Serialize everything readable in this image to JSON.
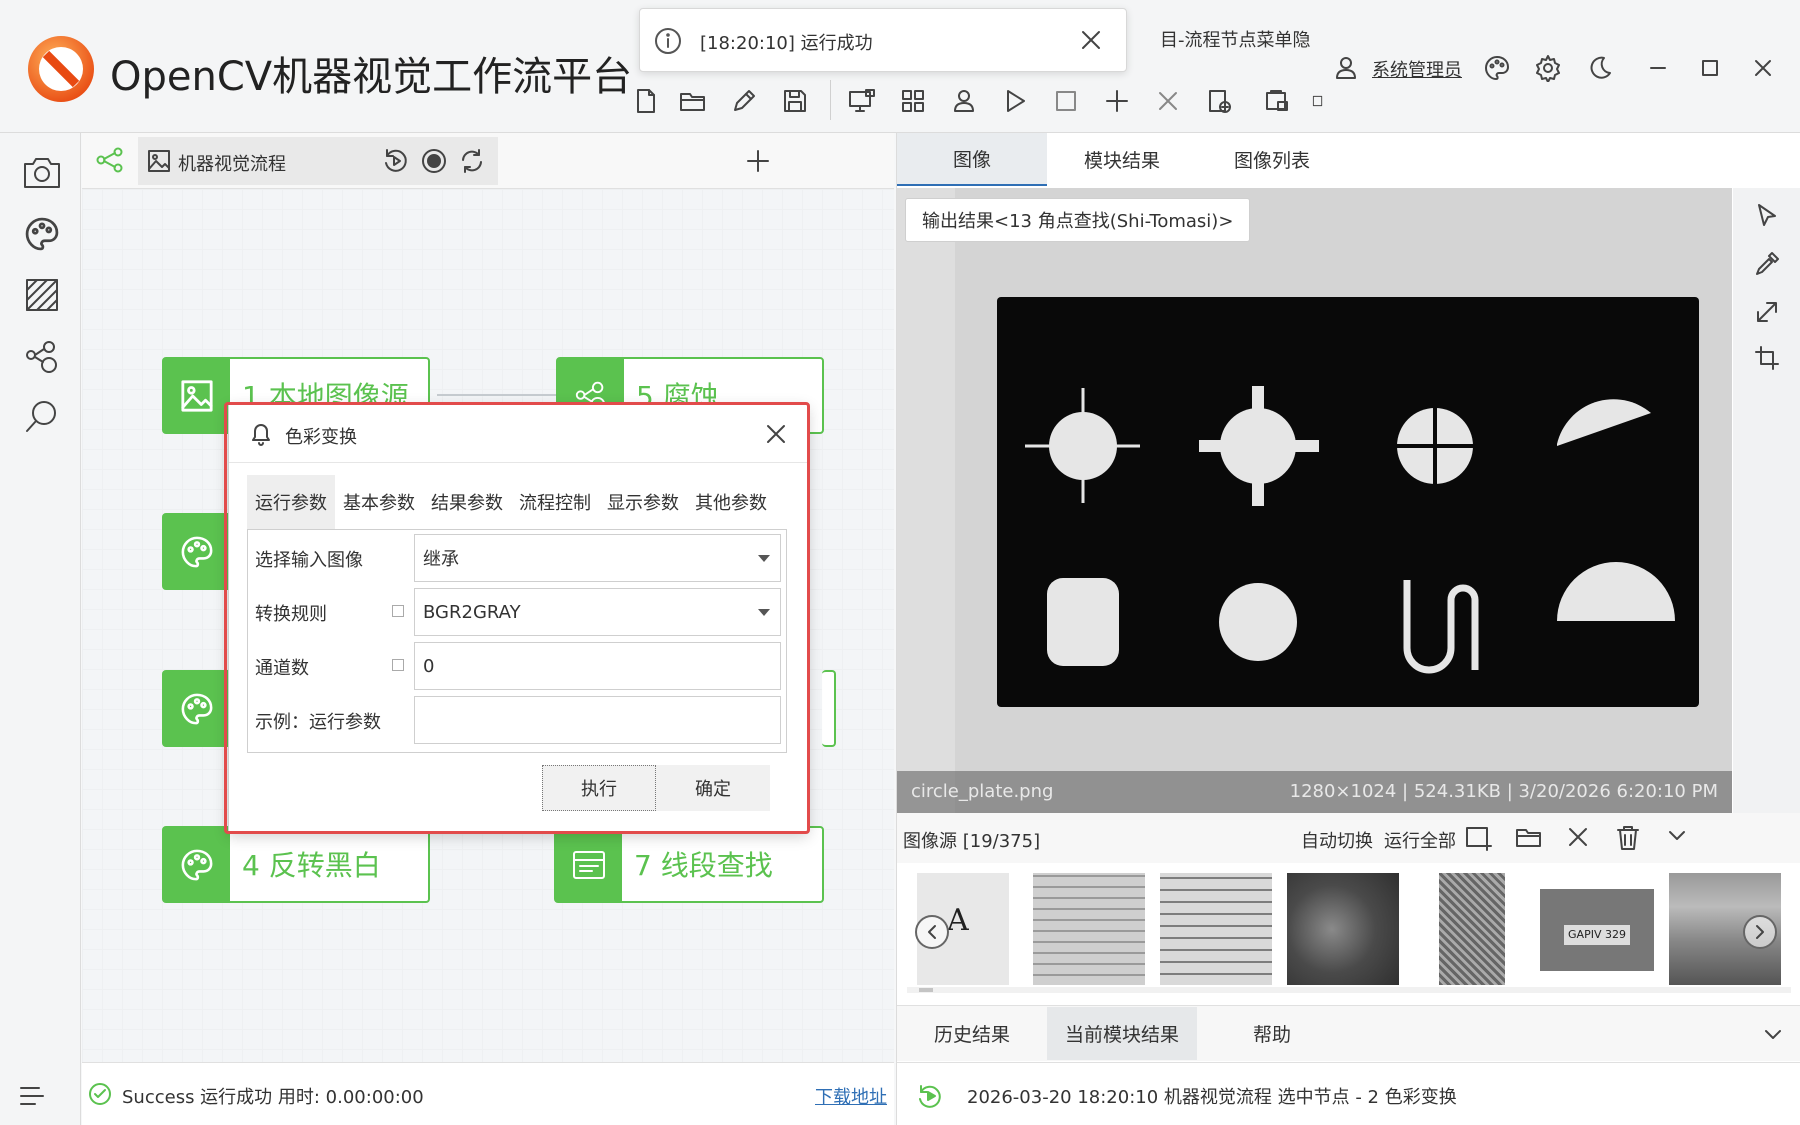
{
  "app": {
    "title": "OpenCV机器视觉工作流平台"
  },
  "toast": {
    "message": "[18:20:10] 运行成功"
  },
  "header": {
    "hidden_text": "目-流程节点菜单隐",
    "user": "系统管理员"
  },
  "toolbar": {
    "icons": [
      "new-file-icon",
      "open-folder-icon",
      "edit-icon",
      "save-icon",
      "monitor-icon",
      "modules-icon",
      "user-icon",
      "play-icon",
      "stop-icon",
      "add-icon",
      "delete-icon",
      "export-icon",
      "import-icon"
    ]
  },
  "flow": {
    "tab_title": "机器视觉流程",
    "nodes": [
      {
        "label": "1 本地图像源"
      },
      {
        "label": "5 腐蚀"
      },
      {
        "label": "4 反转黑白"
      },
      {
        "label": "7 线段查找"
      }
    ]
  },
  "status": {
    "text": "Success 运行成功 用时: 0.00:00:00",
    "download_link": "下载地址"
  },
  "right": {
    "tabs": [
      "图像",
      "模块结果",
      "图像列表"
    ],
    "overlay_button": "输出结果<13 角点查找(Shi-Tomasi)>",
    "image_filename": "circle_plate.png",
    "image_info": "1280×1024 | 524.31KB | 3/20/2026 6:20:10 PM",
    "source_label": "图像源 [19/375]",
    "auto_switch": "自动切换",
    "run_all": "运行全部",
    "bottom_tabs": [
      "历史结果",
      "当前模块结果",
      "帮助"
    ],
    "log_text": "2026-03-20 18:20:10 机器视觉流程 选中节点 - 2 色彩变换",
    "thumb_plate_text": "GAPIV 329",
    "thumb_letter": "A"
  },
  "dialog": {
    "title": "色彩变换",
    "tabs": [
      "运行参数",
      "基本参数",
      "结果参数",
      "流程控制",
      "显示参数",
      "其他参数"
    ],
    "rows": [
      {
        "label": "选择输入图像",
        "value": ""
      },
      {
        "label": "转换规则",
        "value": ""
      },
      {
        "label": "通道数",
        "value": "0"
      },
      {
        "label": "示例：运行参数",
        "value": ""
      }
    ],
    "row_values": {
      "input_image": "继承",
      "convert_rule": "BGR2GRAY"
    },
    "execute_button": "执行",
    "confirm_button": "确定"
  },
  "colors": {
    "accent_green": "#5bc24f",
    "highlight_red": "#e24b4b",
    "tab_blue": "#2f6fb5"
  }
}
